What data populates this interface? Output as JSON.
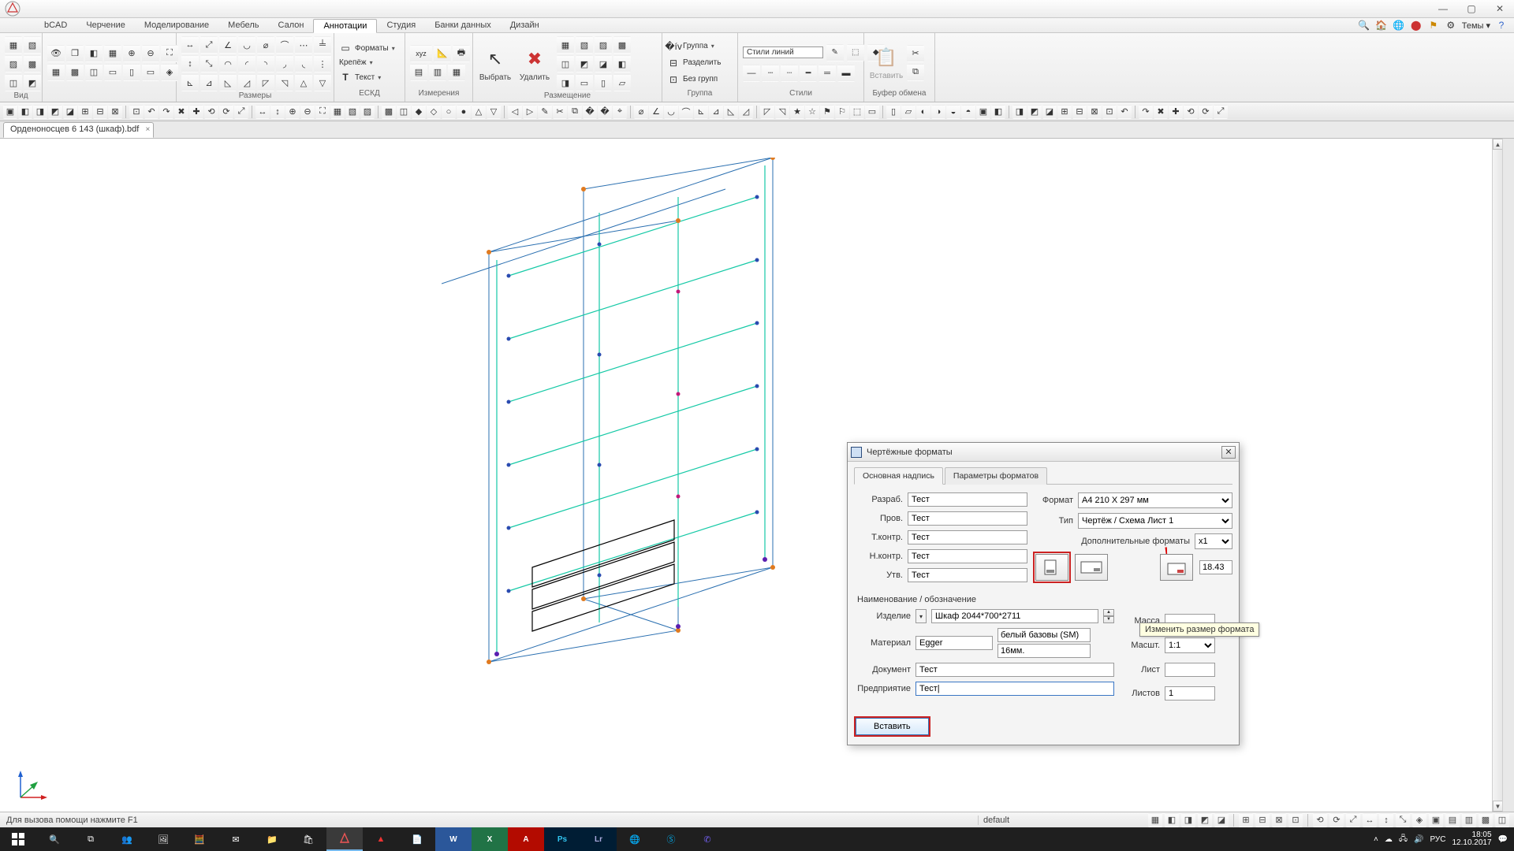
{
  "titlebar": {
    "min": "—",
    "max": "▢",
    "close": "✕"
  },
  "menubar": {
    "tabs": [
      "bCAD",
      "Черчение",
      "Моделирование",
      "Мебель",
      "Салон",
      "Аннотации",
      "Студия",
      "Банки данных",
      "Дизайн"
    ],
    "active_index": 5,
    "themes_label": "Темы"
  },
  "ribbon": {
    "groups": {
      "view": "Вид",
      "sizes": "Размеры",
      "text_formats": "Форматы",
      "text_fasteners": "Крепёж",
      "text_text": "Текст",
      "eskd": "ЕСКД",
      "measure": "Измерения",
      "select": "Выбрать",
      "delete": "Удалить",
      "placement": "Размещение",
      "group_menu": "Группа",
      "group_split": "Разделить",
      "group_none": "Без групп",
      "group_section": "Группа",
      "styles_label": "Стили линий",
      "styles_section": "Стили",
      "insert": "Вставить",
      "clipboard": "Буфер обмена"
    }
  },
  "doc_tab": {
    "name": "Орденоносцев 6 143 (шкаф).bdf"
  },
  "dialog": {
    "title": "Чертёжные форматы",
    "tabs": [
      "Основная надпись",
      "Параметры форматов"
    ],
    "left_labels": {
      "razrab": "Разраб.",
      "prov": "Пров.",
      "tkontr": "Т.контр.",
      "nkontr": "Н.контр.",
      "utv": "Утв."
    },
    "left_values": {
      "razrab": "Тест",
      "prov": "Тест",
      "tkontr": "Тест",
      "nkontr": "Тест",
      "utv": "Тест"
    },
    "right_labels": {
      "format": "Формат",
      "type": "Тип",
      "extra": "Дополнительные форматы"
    },
    "right_values": {
      "format": "A4 210 X 297 мм",
      "type": "Чертёж / Схема Лист 1",
      "extra": "x1",
      "ratio": "18.43"
    },
    "section2_title": "Наименование / обозначение",
    "section2": {
      "izdelie_label": "Изделие",
      "izdelie": "Шкаф 2044*700*2711",
      "material_label": "Материал",
      "material": "Egger",
      "material2": "белый базовы (SM)",
      "material3": "16мм.",
      "document_label": "Документ",
      "document": "Тест",
      "company_label": "Предприятие",
      "company": "Тест|"
    },
    "col_right2": {
      "mass": "Масса",
      "mass_val": "",
      "scale": "Масшт.",
      "scale_val": "1:1",
      "sheet": "Лист",
      "sheet_val": "",
      "sheets": "Листов",
      "sheets_val": "1"
    },
    "tooltip": "Изменить размер формата",
    "insert_btn": "Вставить"
  },
  "status": {
    "help": "Для вызова помощи нажмите F1",
    "layer": "default"
  },
  "tray": {
    "lang": "РУС",
    "time": "18:05",
    "date": "12.10.2017"
  }
}
